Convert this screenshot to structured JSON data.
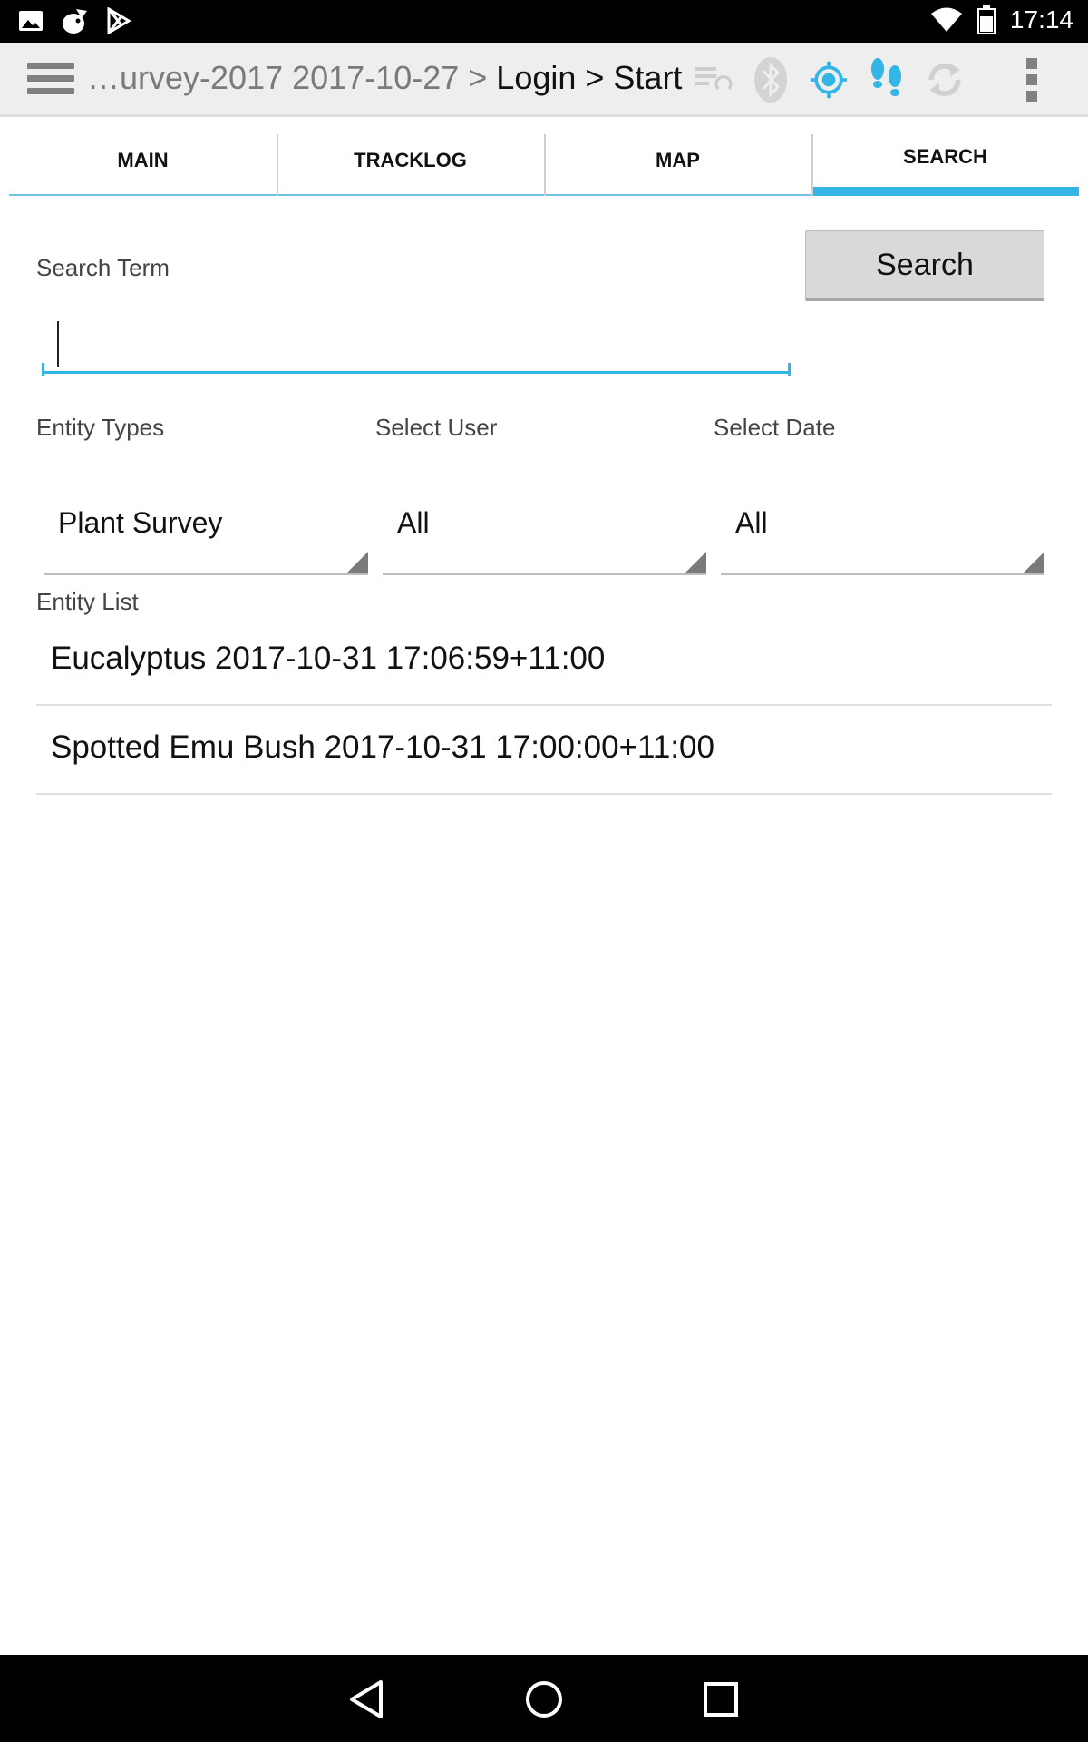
{
  "status_bar": {
    "time": "17:14",
    "left_icons": [
      "image-icon",
      "cat-icon",
      "play-store-icon"
    ],
    "right_icons": [
      "wifi-icon",
      "battery-icon"
    ]
  },
  "app_bar": {
    "breadcrumb_dim": "…urvey-2017 2017-10-27 > ",
    "breadcrumb_dark": "Login > Start",
    "icons": [
      "sync-list-icon",
      "bluetooth-icon",
      "gps-icon",
      "tracklog-footsteps-icon",
      "sync-icon",
      "overflow-menu-icon"
    ],
    "accent_color": "#33b5e5"
  },
  "tabs": [
    {
      "label": "MAIN",
      "active": false
    },
    {
      "label": "TRACKLOG",
      "active": false
    },
    {
      "label": "MAP",
      "active": false
    },
    {
      "label": "SEARCH",
      "active": true
    }
  ],
  "search": {
    "term_label": "Search Term",
    "button_label": "Search",
    "value": ""
  },
  "filters": {
    "entity_types_label": "Entity Types",
    "select_user_label": "Select User",
    "select_date_label": "Select Date",
    "entity_type_value": "Plant Survey",
    "user_value": "All",
    "date_value": "All"
  },
  "entity_list": {
    "label": "Entity List",
    "items": [
      "Eucalyptus 2017-10-31 17:06:59+11:00",
      "Spotted Emu Bush 2017-10-31 17:00:00+11:00"
    ]
  },
  "nav_bar": {
    "icons": [
      "back-icon",
      "home-icon",
      "recents-icon"
    ]
  }
}
